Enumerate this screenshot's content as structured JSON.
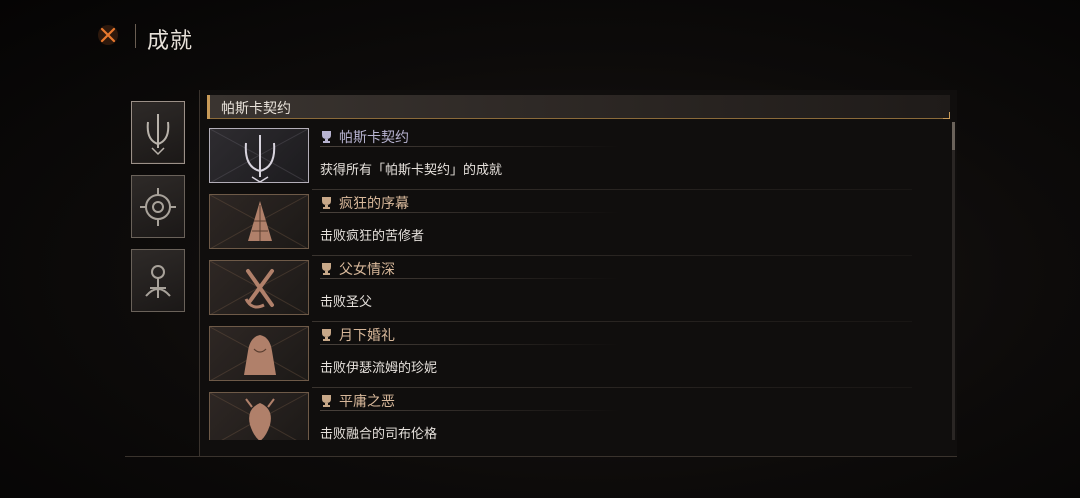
{
  "header": {
    "title": "成就",
    "close_icon": "close-x-icon"
  },
  "categories": [
    {
      "icon": "pascal-emblem-icon",
      "active": true
    },
    {
      "icon": "compass-sigil-icon",
      "active": false
    },
    {
      "icon": "cult-sigil-icon",
      "active": false
    }
  ],
  "section": {
    "title": "帕斯卡契约"
  },
  "achievements": [
    {
      "title": "帕斯卡契约",
      "description": "获得所有「帕斯卡契约」的成就",
      "unlocked": true,
      "icon": "pascal-emblem-icon"
    },
    {
      "title": "疯狂的序幕",
      "description": "击败疯狂的苦修者",
      "unlocked": false,
      "icon": "spire-icon"
    },
    {
      "title": "父女情深",
      "description": "击败圣父",
      "unlocked": false,
      "icon": "blades-icon"
    },
    {
      "title": "月下婚礼",
      "description": "击败伊瑟流姆的珍妮",
      "unlocked": false,
      "icon": "veiled-bride-icon"
    },
    {
      "title": "平庸之恶",
      "description": "击败融合的司布伦格",
      "unlocked": false,
      "icon": "fused-beast-icon"
    }
  ],
  "colors": {
    "locked_title": "#d8b89a",
    "unlocked_title": "#b7b3d0",
    "accent": "#c89a58",
    "close_icon": "#e0702a"
  }
}
